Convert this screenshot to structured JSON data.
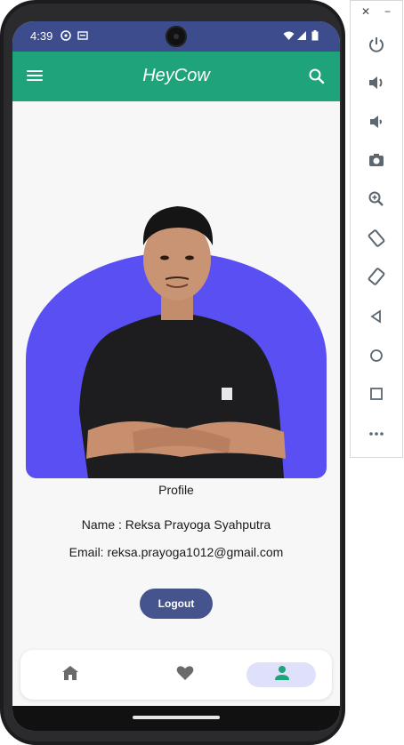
{
  "status_bar": {
    "time": "4:39"
  },
  "app_bar": {
    "title": "HeyCow"
  },
  "profile": {
    "label": "Profile",
    "name_line": "Name : Reksa Prayoga Syahputra",
    "email_line": "Email: reksa.prayoga1012@gmail.com"
  },
  "logout_label": "Logout",
  "bottom_nav": {
    "items": [
      "home-icon",
      "favorite-icon",
      "profile-icon"
    ],
    "active_index": 2
  },
  "colors": {
    "status_bar": "#3c4c8c",
    "app_bar": "#1fa37b",
    "profile_bg": "#5a4ff3",
    "logout_button": "#45548c",
    "nav_active": "#dfe1fb",
    "nav_active_icon": "#1fa37b"
  },
  "emulator_panel": {
    "window_controls": [
      "close-icon",
      "minimize-icon"
    ],
    "buttons": [
      "power-icon",
      "volume-up-icon",
      "volume-down-icon",
      "camera-icon",
      "zoom-in-icon",
      "rotate-left-icon",
      "rotate-right-icon",
      "back-icon",
      "home-circle-icon",
      "overview-icon",
      "more-icon"
    ]
  }
}
